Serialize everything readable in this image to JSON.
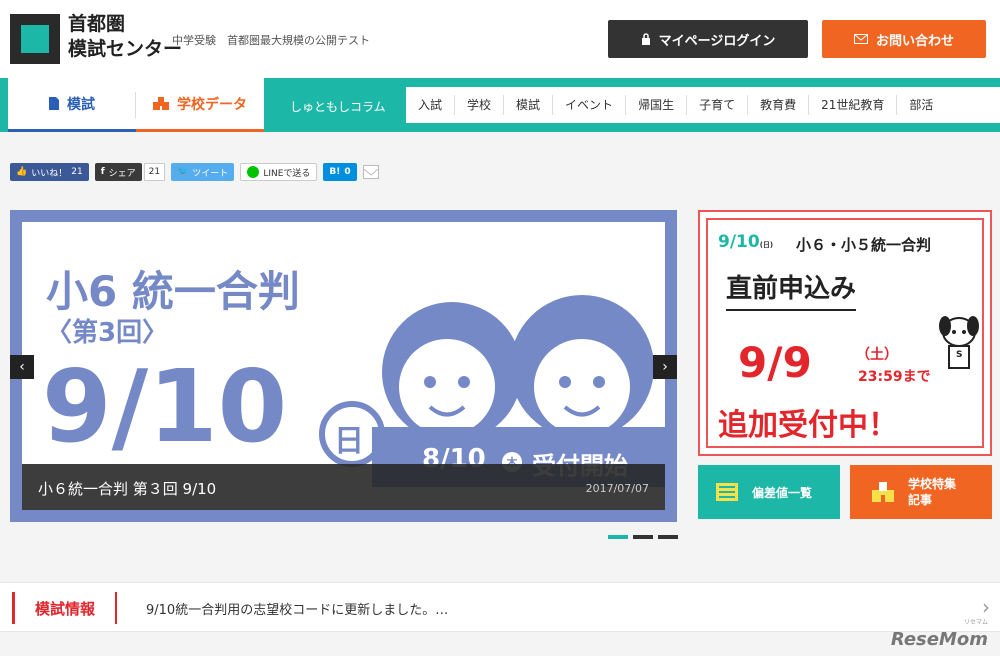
{
  "header": {
    "logo_line1": "首都圏",
    "logo_line2": "模試センター",
    "tagline": "中学受験　首都圏最大規模の公開テスト",
    "mypage_label": "マイページログイン",
    "contact_label": "お問い合わせ"
  },
  "nav": {
    "tab_moshi": "模試",
    "tab_school": "学校データ",
    "column_label": "しゅともしコラム",
    "categories": [
      "入試",
      "学校",
      "模試",
      "イベント",
      "帰国生",
      "子育て",
      "教育費",
      "21世紀教育",
      "部活"
    ]
  },
  "social": {
    "like_label": "いいね！",
    "like_count": "21",
    "share_label": "シェア",
    "share_count": "21",
    "tweet_label": "ツイート",
    "line_label": "LINEで送る",
    "hatena_label": "B!",
    "hatena_count": "0"
  },
  "slider": {
    "headline": "小6  統一合判",
    "round": "〈第3回〉",
    "date_big": "9/10",
    "weekday": "日",
    "open_date": "8/10",
    "open_weekday": "木",
    "open_text": "受付開始",
    "caption_title": "小６統一合判 第３回 9/10",
    "caption_date": "2017/07/07",
    "prev_icon": "‹",
    "next_icon": "›",
    "active_index": 0,
    "dot_count": 3
  },
  "promo": {
    "date": "9/10",
    "date_day": "(日)",
    "title": "小６・小５統一合判",
    "subtitle": "直前申込み",
    "deadline_date": "9/9",
    "deadline_day": "（土）",
    "deadline_time": "23:59まで",
    "additional": "追加受付中！",
    "mascot_badge": "S"
  },
  "tiles": {
    "deviation": "偏差値一覧",
    "feature_line1": "学校特集",
    "feature_line2": "記事"
  },
  "news": {
    "label": "模試情報",
    "text": "9/10統一合判用の志望校コードに更新しました。…",
    "arrow": "›"
  },
  "watermark": {
    "small": "リセマム",
    "text": "ReseMom"
  },
  "colors": {
    "teal": "#1cb7a6",
    "orange": "#f16522",
    "slide_blue": "#7589c7",
    "red": "#e2262c"
  }
}
